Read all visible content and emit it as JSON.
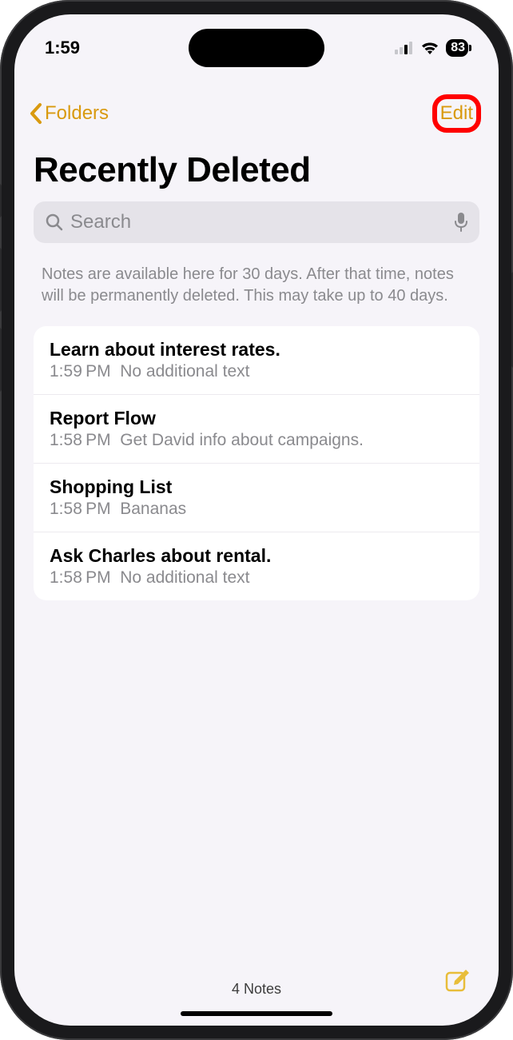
{
  "status": {
    "time": "1:59",
    "battery": "83"
  },
  "nav": {
    "back_label": "Folders",
    "edit_label": "Edit"
  },
  "title": "Recently Deleted",
  "search": {
    "placeholder": "Search"
  },
  "info_text": "Notes are available here for 30 days. After that time, notes will be permanently deleted. This may take up to 40 days.",
  "notes": [
    {
      "title": "Learn about interest rates.",
      "time": "1:59 PM",
      "preview": "No additional text"
    },
    {
      "title": "Report Flow",
      "time": "1:58 PM",
      "preview": "Get David info about campaigns."
    },
    {
      "title": "Shopping List",
      "time": "1:58 PM",
      "preview": "Bananas"
    },
    {
      "title": "Ask Charles about rental.",
      "time": "1:58 PM",
      "preview": "No additional text"
    }
  ],
  "footer": {
    "count_label": "4 Notes"
  }
}
